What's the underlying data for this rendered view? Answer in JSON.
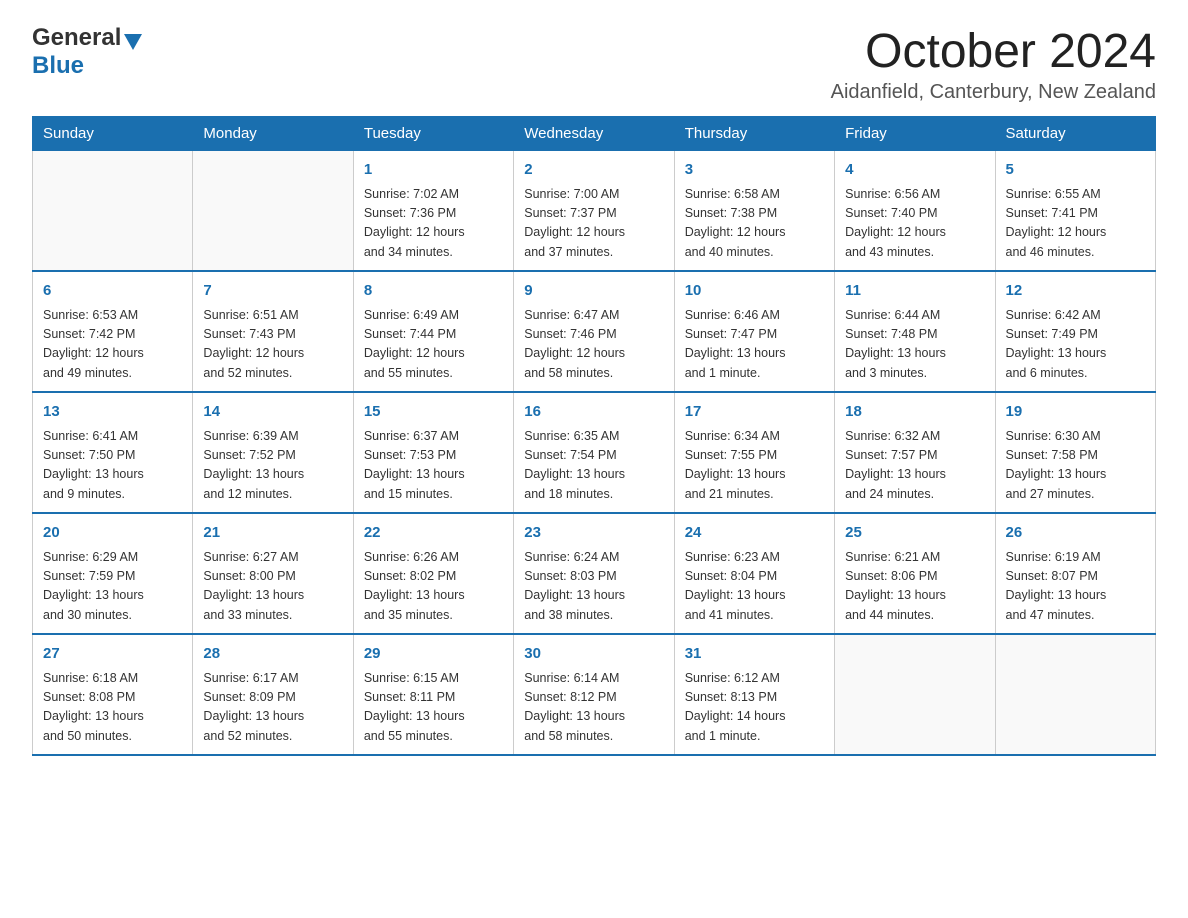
{
  "header": {
    "logo_general": "General",
    "logo_blue": "Blue",
    "month_title": "October 2024",
    "location": "Aidanfield, Canterbury, New Zealand"
  },
  "calendar": {
    "days_of_week": [
      "Sunday",
      "Monday",
      "Tuesday",
      "Wednesday",
      "Thursday",
      "Friday",
      "Saturday"
    ],
    "weeks": [
      [
        {
          "day": "",
          "info": ""
        },
        {
          "day": "",
          "info": ""
        },
        {
          "day": "1",
          "info": "Sunrise: 7:02 AM\nSunset: 7:36 PM\nDaylight: 12 hours\nand 34 minutes."
        },
        {
          "day": "2",
          "info": "Sunrise: 7:00 AM\nSunset: 7:37 PM\nDaylight: 12 hours\nand 37 minutes."
        },
        {
          "day": "3",
          "info": "Sunrise: 6:58 AM\nSunset: 7:38 PM\nDaylight: 12 hours\nand 40 minutes."
        },
        {
          "day": "4",
          "info": "Sunrise: 6:56 AM\nSunset: 7:40 PM\nDaylight: 12 hours\nand 43 minutes."
        },
        {
          "day": "5",
          "info": "Sunrise: 6:55 AM\nSunset: 7:41 PM\nDaylight: 12 hours\nand 46 minutes."
        }
      ],
      [
        {
          "day": "6",
          "info": "Sunrise: 6:53 AM\nSunset: 7:42 PM\nDaylight: 12 hours\nand 49 minutes."
        },
        {
          "day": "7",
          "info": "Sunrise: 6:51 AM\nSunset: 7:43 PM\nDaylight: 12 hours\nand 52 minutes."
        },
        {
          "day": "8",
          "info": "Sunrise: 6:49 AM\nSunset: 7:44 PM\nDaylight: 12 hours\nand 55 minutes."
        },
        {
          "day": "9",
          "info": "Sunrise: 6:47 AM\nSunset: 7:46 PM\nDaylight: 12 hours\nand 58 minutes."
        },
        {
          "day": "10",
          "info": "Sunrise: 6:46 AM\nSunset: 7:47 PM\nDaylight: 13 hours\nand 1 minute."
        },
        {
          "day": "11",
          "info": "Sunrise: 6:44 AM\nSunset: 7:48 PM\nDaylight: 13 hours\nand 3 minutes."
        },
        {
          "day": "12",
          "info": "Sunrise: 6:42 AM\nSunset: 7:49 PM\nDaylight: 13 hours\nand 6 minutes."
        }
      ],
      [
        {
          "day": "13",
          "info": "Sunrise: 6:41 AM\nSunset: 7:50 PM\nDaylight: 13 hours\nand 9 minutes."
        },
        {
          "day": "14",
          "info": "Sunrise: 6:39 AM\nSunset: 7:52 PM\nDaylight: 13 hours\nand 12 minutes."
        },
        {
          "day": "15",
          "info": "Sunrise: 6:37 AM\nSunset: 7:53 PM\nDaylight: 13 hours\nand 15 minutes."
        },
        {
          "day": "16",
          "info": "Sunrise: 6:35 AM\nSunset: 7:54 PM\nDaylight: 13 hours\nand 18 minutes."
        },
        {
          "day": "17",
          "info": "Sunrise: 6:34 AM\nSunset: 7:55 PM\nDaylight: 13 hours\nand 21 minutes."
        },
        {
          "day": "18",
          "info": "Sunrise: 6:32 AM\nSunset: 7:57 PM\nDaylight: 13 hours\nand 24 minutes."
        },
        {
          "day": "19",
          "info": "Sunrise: 6:30 AM\nSunset: 7:58 PM\nDaylight: 13 hours\nand 27 minutes."
        }
      ],
      [
        {
          "day": "20",
          "info": "Sunrise: 6:29 AM\nSunset: 7:59 PM\nDaylight: 13 hours\nand 30 minutes."
        },
        {
          "day": "21",
          "info": "Sunrise: 6:27 AM\nSunset: 8:00 PM\nDaylight: 13 hours\nand 33 minutes."
        },
        {
          "day": "22",
          "info": "Sunrise: 6:26 AM\nSunset: 8:02 PM\nDaylight: 13 hours\nand 35 minutes."
        },
        {
          "day": "23",
          "info": "Sunrise: 6:24 AM\nSunset: 8:03 PM\nDaylight: 13 hours\nand 38 minutes."
        },
        {
          "day": "24",
          "info": "Sunrise: 6:23 AM\nSunset: 8:04 PM\nDaylight: 13 hours\nand 41 minutes."
        },
        {
          "day": "25",
          "info": "Sunrise: 6:21 AM\nSunset: 8:06 PM\nDaylight: 13 hours\nand 44 minutes."
        },
        {
          "day": "26",
          "info": "Sunrise: 6:19 AM\nSunset: 8:07 PM\nDaylight: 13 hours\nand 47 minutes."
        }
      ],
      [
        {
          "day": "27",
          "info": "Sunrise: 6:18 AM\nSunset: 8:08 PM\nDaylight: 13 hours\nand 50 minutes."
        },
        {
          "day": "28",
          "info": "Sunrise: 6:17 AM\nSunset: 8:09 PM\nDaylight: 13 hours\nand 52 minutes."
        },
        {
          "day": "29",
          "info": "Sunrise: 6:15 AM\nSunset: 8:11 PM\nDaylight: 13 hours\nand 55 minutes."
        },
        {
          "day": "30",
          "info": "Sunrise: 6:14 AM\nSunset: 8:12 PM\nDaylight: 13 hours\nand 58 minutes."
        },
        {
          "day": "31",
          "info": "Sunrise: 6:12 AM\nSunset: 8:13 PM\nDaylight: 14 hours\nand 1 minute."
        },
        {
          "day": "",
          "info": ""
        },
        {
          "day": "",
          "info": ""
        }
      ]
    ]
  }
}
